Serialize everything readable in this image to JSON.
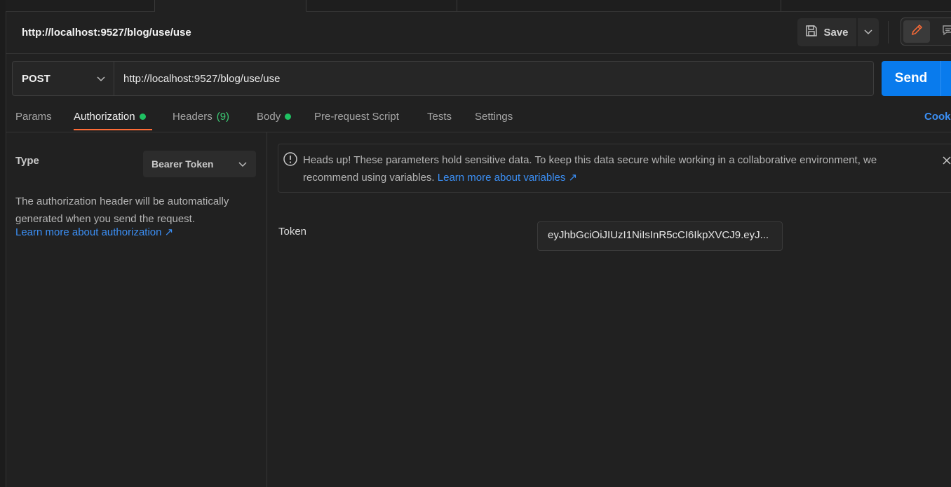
{
  "request": {
    "title": "http://localhost:9527/blog/use/use",
    "method": "POST",
    "url": "http://localhost:9527/blog/use/use"
  },
  "toolbar": {
    "save_label": "Save",
    "send_label": "Send"
  },
  "request_tabs": {
    "params": "Params",
    "authorization": "Authorization",
    "headers": "Headers",
    "headers_count": "(9)",
    "body": "Body",
    "prerequest": "Pre-request Script",
    "tests": "Tests",
    "settings": "Settings",
    "cookies": "Cookies",
    "active": "Authorization"
  },
  "auth": {
    "type_label": "Type",
    "type_value": "Bearer Token",
    "description": "The authorization header will be automatically generated when you send the request.",
    "learn_more": "Learn more about authorization ↗",
    "notice_text": "Heads up! These parameters hold sensitive data. To keep this data secure while working in a collaborative environment, we recommend using variables.",
    "notice_link": "Learn more about variables ↗",
    "token_label": "Token",
    "token_value": "eyJhbGciOiJIUzI1NiIsInR5cCI6IkpXVCJ9.eyJ..."
  },
  "colors": {
    "accent": "#ff6c37",
    "send_button": "#097bed",
    "link": "#3b8ff5",
    "status_dot": "#1fc162"
  }
}
